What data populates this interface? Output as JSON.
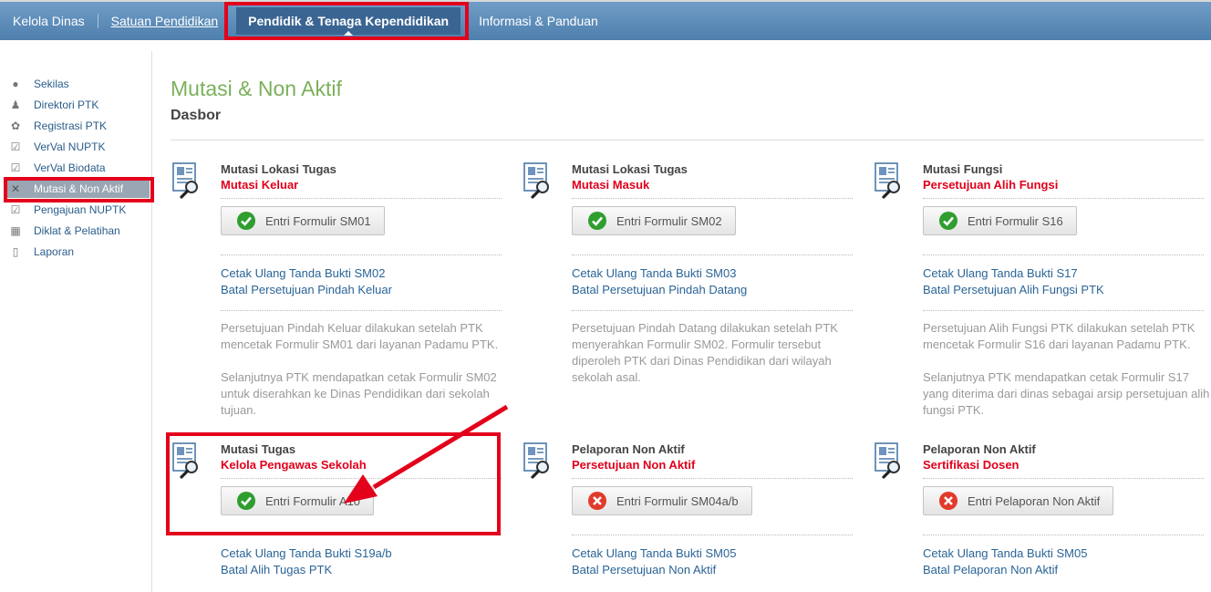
{
  "topnav": {
    "items": [
      "Kelola Dinas",
      "Satuan Pendidikan",
      "Pendidik & Tenaga Kependidikan",
      "Informasi & Panduan"
    ]
  },
  "sidebar": {
    "items": [
      {
        "label": "Sekilas",
        "icon": "info-icon"
      },
      {
        "label": "Direktori PTK",
        "icon": "person-icon"
      },
      {
        "label": "Registrasi PTK",
        "icon": "people-icon"
      },
      {
        "label": "VerVal NUPTK",
        "icon": "clipboard-icon"
      },
      {
        "label": "VerVal Biodata",
        "icon": "clipboard-icon"
      },
      {
        "label": "Mutasi & Non Aktif",
        "icon": "close-icon"
      },
      {
        "label": "Pengajuan NUPTK",
        "icon": "clipboard-icon"
      },
      {
        "label": "Diklat & Pelatihan",
        "icon": "chart-icon"
      },
      {
        "label": "Laporan",
        "icon": "document-icon"
      }
    ]
  },
  "page": {
    "title": "Mutasi & Non Aktif",
    "subtitle": "Dasbor"
  },
  "cards": [
    {
      "h1": "Mutasi Lokasi Tugas",
      "h2": "Mutasi Keluar",
      "button": "Entri Formulir SM01",
      "button_icon": "check-icon",
      "links": [
        "Cetak Ulang Tanda Bukti SM02",
        "Batal Persetujuan Pindah Keluar"
      ],
      "desc1": "Persetujuan Pindah Keluar dilakukan setelah PTK mencetak Formulir SM01 dari layanan Padamu PTK.",
      "desc2": "Selanjutnya PTK mendapatkan cetak Formulir SM02 untuk diserahkan ke Dinas Pendidikan dari sekolah tujuan."
    },
    {
      "h1": "Mutasi Lokasi Tugas",
      "h2": "Mutasi Masuk",
      "button": "Entri Formulir SM02",
      "button_icon": "check-icon",
      "links": [
        "Cetak Ulang Tanda Bukti SM03",
        "Batal Persetujuan Pindah Datang"
      ],
      "desc1": "Persetujuan Pindah Datang dilakukan setelah PTK menyerahkan Formulir SM02. Formulir tersebut diperoleh PTK dari Dinas Pendidikan dari wilayah sekolah asal.",
      "desc2": ""
    },
    {
      "h1": "Mutasi Fungsi",
      "h2": "Persetujuan Alih Fungsi",
      "button": "Entri Formulir S16",
      "button_icon": "check-icon",
      "links": [
        "Cetak Ulang Tanda Bukti S17",
        "Batal Persetujuan Alih Fungsi PTK"
      ],
      "desc1": "Persetujuan Alih Fungsi PTK dilakukan setelah PTK mencetak Formulir S16 dari layanan Padamu PTK.",
      "desc2": "Selanjutnya PTK mendapatkan cetak Formulir S17 yang diterima dari dinas sebagai arsip persetujuan alih fungsi PTK."
    },
    {
      "h1": "Mutasi Tugas",
      "h2": "Kelola Pengawas Sekolah",
      "button": "Entri Formulir A10",
      "button_icon": "check-icon",
      "links": [
        "Cetak Ulang Tanda Bukti S19a/b",
        "Batal Alih Tugas PTK"
      ],
      "desc1": "",
      "desc2": ""
    },
    {
      "h1": "Pelaporan Non Aktif",
      "h2": "Persetujuan Non Aktif",
      "button": "Entri Formulir SM04a/b",
      "button_icon": "cancel-icon",
      "links": [
        "Cetak Ulang Tanda Bukti SM05",
        "Batal Persetujuan Non Aktif"
      ],
      "desc1": "",
      "desc2": ""
    },
    {
      "h1": "Pelaporan Non Aktif",
      "h2": "Sertifikasi Dosen",
      "button": "Entri Pelaporan Non Aktif",
      "button_icon": "cancel-icon",
      "links": [
        "Cetak Ulang Tanda Bukti SM05",
        "Batal Pelaporan Non Aktif"
      ],
      "desc1": "",
      "desc2": ""
    }
  ],
  "colors": {
    "nav_bg": "#5b8bb9",
    "title_green": "#7ab05a",
    "heading_red": "#e0001b",
    "link_blue": "#2a6496",
    "highlight_red": "#e3001b"
  }
}
